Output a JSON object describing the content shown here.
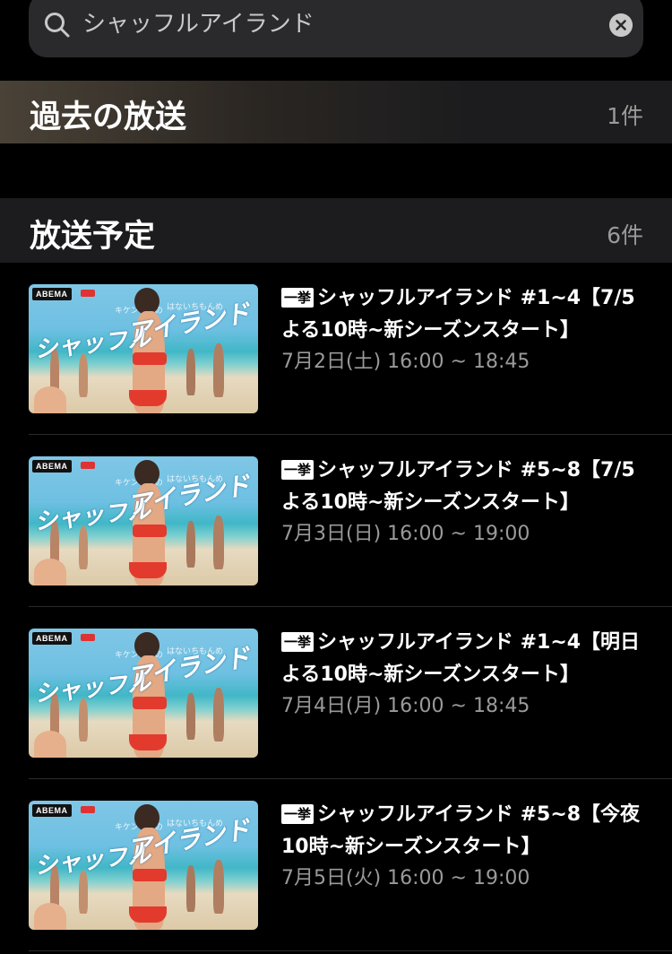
{
  "search": {
    "query": "シャッフルアイランド"
  },
  "sections": {
    "past": {
      "title": "過去の放送",
      "count": "1件"
    },
    "upcoming": {
      "title": "放送予定",
      "count": "6件"
    }
  },
  "programs": [
    {
      "badge": "一挙",
      "title_line1": "シャッフルアイランド #1~4【7/5",
      "title_line2": "よる10時~新シーズンスタート】",
      "airtime": "7月2日(土) 16:00 ~ 18:45"
    },
    {
      "badge": "一挙",
      "title_line1": "シャッフルアイランド #5~8【7/5",
      "title_line2": "よる10時~新シーズンスタート】",
      "airtime": "7月3日(日) 16:00 ~ 19:00"
    },
    {
      "badge": "一挙",
      "title_line1": "シャッフルアイランド #1~4【明日",
      "title_line2": "よる10時~新シーズンスタート】",
      "airtime": "7月4日(月) 16:00 ~ 18:45"
    },
    {
      "badge": "一挙",
      "title_line1": "シャッフルアイランド #5~8【今夜",
      "title_line2": "10時~新シーズンスタート】",
      "airtime": "7月5日(火) 16:00 ~ 19:00"
    }
  ],
  "thumbnail": {
    "logo": "ABEMA",
    "tagline_left": "キケンな恋の",
    "tagline_right": "はないちもんめ",
    "title_left": "シャッフル",
    "title_right": "アイランド"
  }
}
